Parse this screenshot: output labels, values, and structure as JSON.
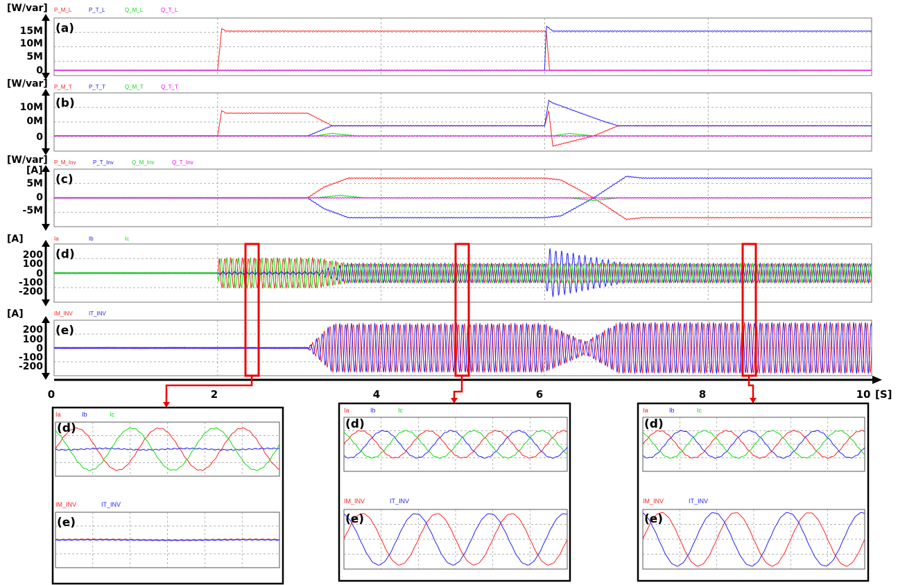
{
  "chart_data": {
    "type": "line",
    "x_axis": {
      "ticks": [
        "0",
        "2",
        "4",
        "6",
        "8",
        "10"
      ],
      "unit": "[S]",
      "range": [
        0,
        10
      ]
    },
    "colors": {
      "red": "#ff2020",
      "blue": "#2020ff",
      "green": "#10dd10",
      "magenta": "#ff00ff",
      "highlight": "#ee0000"
    },
    "panels": [
      {
        "id": "a",
        "label": "(a)",
        "ylabel": "[W/var]",
        "yticks": [
          "15M",
          "10M",
          "5M",
          "0"
        ],
        "ylim": [
          -2,
          20
        ],
        "legend": [
          "P_M_L",
          "P_T_L",
          "Q_M_L",
          "Q_T_L"
        ],
        "series": [
          {
            "name": "P_M_L",
            "color": "red",
            "x": [
              0,
              2,
              2.05,
              2.1,
              6.0,
              6.02,
              6.06,
              10
            ],
            "y": [
              0,
              0,
              16,
              15,
              15,
              15,
              0,
              0
            ]
          },
          {
            "name": "P_T_L",
            "color": "blue",
            "x": [
              0,
              6.0,
              6.02,
              6.06,
              6.1,
              10
            ],
            "y": [
              0,
              0,
              17,
              16,
              15,
              15
            ]
          },
          {
            "name": "Q_M_L",
            "color": "green",
            "x": [
              0,
              10
            ],
            "y": [
              0,
              0
            ]
          },
          {
            "name": "Q_T_L",
            "color": "magenta",
            "x": [
              0,
              10
            ],
            "y": [
              0,
              0
            ]
          }
        ]
      },
      {
        "id": "b",
        "label": "(b)",
        "ylabel": "[W/var]",
        "yticks": [
          "10M",
          "0M",
          "0"
        ],
        "ylim": [
          -6,
          17
        ],
        "legend": [
          "P_M_T",
          "P_T_T",
          "Q_M_T",
          "Q_T_T"
        ],
        "series": [
          {
            "name": "P_M_T",
            "color": "red",
            "x": [
              0,
              2,
              2.05,
              2.1,
              3.1,
              3.4,
              3.5,
              6.0,
              6.05,
              6.1,
              6.6,
              6.9,
              7.1,
              10
            ],
            "y": [
              0,
              0,
              10,
              9,
              9,
              4,
              4,
              4,
              10,
              -4,
              0,
              4,
              4,
              4
            ]
          },
          {
            "name": "P_T_T",
            "color": "blue",
            "x": [
              0,
              3.1,
              3.4,
              3.5,
              6.0,
              6.05,
              6.1,
              6.7,
              6.9,
              7.1,
              10
            ],
            "y": [
              0,
              0,
              4,
              4,
              4,
              14,
              13,
              6,
              4,
              4,
              4
            ]
          },
          {
            "name": "Q_M_T",
            "color": "green",
            "x": [
              0,
              3.2,
              3.4,
              3.7,
              6.1,
              6.3,
              6.6,
              10
            ],
            "y": [
              0,
              0,
              1,
              0,
              0,
              1,
              0,
              0
            ]
          },
          {
            "name": "Q_T_T",
            "color": "magenta",
            "x": [
              0,
              10
            ],
            "y": [
              0,
              0
            ]
          }
        ]
      },
      {
        "id": "c",
        "label": "(c)",
        "ylabel": "[W/var]",
        "ylabel2": "[A]",
        "yticks": [
          "5M",
          "0",
          "-5M"
        ],
        "ylim": [
          -8,
          8
        ],
        "legend": [
          "P_M_Inv",
          "P_T_Inv",
          "Q_M_Inv",
          "Q_T_Inv"
        ],
        "series": [
          {
            "name": "P_M_Inv",
            "color": "red",
            "x": [
              0,
              3.1,
              3.3,
              3.6,
              6.0,
              6.2,
              6.6,
              7.0,
              7.2,
              10
            ],
            "y": [
              0,
              0,
              3,
              5.5,
              5.5,
              5,
              0,
              -6,
              -5.5,
              -5.5
            ]
          },
          {
            "name": "P_T_Inv",
            "color": "blue",
            "x": [
              0,
              3.1,
              3.3,
              3.6,
              6.0,
              6.2,
              6.6,
              7.0,
              7.2,
              10
            ],
            "y": [
              0,
              0,
              -3,
              -5.5,
              -5.5,
              -5,
              0,
              6,
              5.5,
              5.5
            ]
          },
          {
            "name": "Q_M_Inv",
            "color": "green",
            "x": [
              0,
              3.2,
              3.5,
              3.8,
              6.3,
              6.6,
              6.9,
              10
            ],
            "y": [
              0,
              0,
              0.7,
              0,
              0,
              -0.7,
              0,
              0
            ]
          },
          {
            "name": "Q_T_Inv",
            "color": "magenta",
            "x": [
              0,
              10
            ],
            "y": [
              0,
              0
            ]
          }
        ]
      },
      {
        "id": "d",
        "label": "(d)",
        "ylabel": "[A]",
        "yticks": [
          "200",
          "100",
          "0",
          "-100",
          "-200"
        ],
        "ylim": [
          -280,
          280
        ],
        "legend": [
          "Ia",
          "Ib",
          "Ic"
        ],
        "series": [
          {
            "name": "Ia",
            "color": "red",
            "x": [
              0,
              2,
              2.02,
              3.2,
              3.6,
              6.0,
              10
            ],
            "amp": [
              0,
              0,
              140,
              140,
              90,
              90,
              90
            ]
          },
          {
            "name": "Ib",
            "color": "blue",
            "x": [
              0,
              2,
              2.02,
              3.2,
              3.6,
              6.0,
              6.05,
              7.0,
              10
            ],
            "amp": [
              0,
              0,
              10,
              10,
              90,
              90,
              230,
              90,
              90
            ]
          },
          {
            "name": "Ic",
            "color": "green",
            "x": [
              0,
              2,
              2.02,
              3.2,
              3.6,
              6.0,
              10
            ],
            "amp": [
              0,
              0,
              140,
              140,
              90,
              90,
              90
            ]
          }
        ]
      },
      {
        "id": "e",
        "label": "(e)",
        "ylabel": "[A]",
        "yticks": [
          "200",
          "100",
          "0",
          "-100",
          "-200"
        ],
        "ylim": [
          -280,
          280
        ],
        "legend": [
          "IM_INV",
          "IT_INV"
        ],
        "series": [
          {
            "name": "IM_INV",
            "color": "red",
            "x": [
              0,
              3.1,
              3.4,
              6.0,
              6.5,
              6.9,
              10
            ],
            "amp": [
              0,
              0,
              240,
              240,
              60,
              250,
              250
            ]
          },
          {
            "name": "IT_INV",
            "color": "blue",
            "x": [
              0,
              3.1,
              3.4,
              6.0,
              6.5,
              6.9,
              10
            ],
            "amp": [
              0,
              0,
              240,
              240,
              60,
              250,
              250
            ]
          }
        ]
      }
    ],
    "zoom_windows": [
      {
        "at_s": 2.45,
        "d_legend": [
          "Ia",
          "Ib",
          "Ic"
        ],
        "e_legend": [
          "IM_INV",
          "IT_INV"
        ],
        "d_amps": {
          "Ia": 140,
          "Ib": 5,
          "Ic": 140
        },
        "e_amps": {
          "IM_INV": 0,
          "IT_INV": 0
        },
        "d_label": "(d)",
        "e_label": "(e)"
      },
      {
        "at_s": 5.0,
        "d_legend": [
          "Ia",
          "Ib",
          "Ic"
        ],
        "e_legend": [
          "IM_INV",
          "IT_INV"
        ],
        "d_amps": {
          "Ia": 90,
          "Ib": 90,
          "Ic": 90
        },
        "e_amps": {
          "IM_INV": 240,
          "IT_INV": 240
        },
        "d_label": "(d)",
        "e_label": "(e)"
      },
      {
        "at_s": 8.6,
        "d_legend": [
          "Ia",
          "Ib",
          "Ic"
        ],
        "e_legend": [
          "IM_INV",
          "IT_INV"
        ],
        "d_amps": {
          "Ia": 90,
          "Ib": 90,
          "Ic": 90
        },
        "e_amps": {
          "IM_INV": 250,
          "IT_INV": 250
        },
        "d_label": "(d)",
        "e_label": "(e)"
      }
    ]
  }
}
